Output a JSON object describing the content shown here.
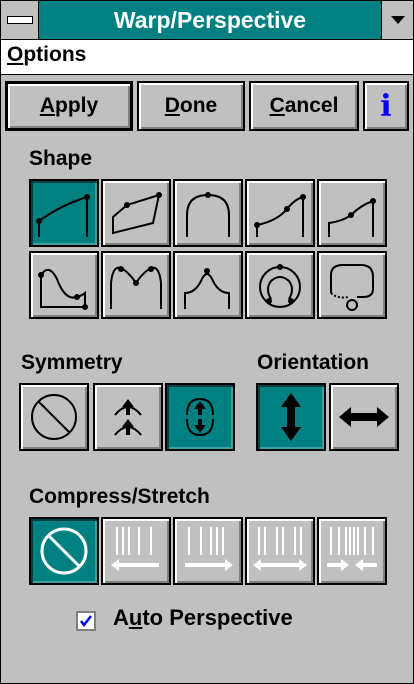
{
  "window": {
    "title": "Warp/Perspective"
  },
  "menu": {
    "options_label": "Options",
    "options_mnemonic": "O",
    "options_rest": "ptions"
  },
  "buttons": {
    "apply": {
      "mn": "A",
      "rest": "pply"
    },
    "done": {
      "mn": "D",
      "rest": "one"
    },
    "cancel": {
      "mn": "C",
      "rest": "ancel"
    },
    "info_glyph": "i"
  },
  "sections": {
    "shape": "Shape",
    "symmetry": "Symmetry",
    "orientation": "Orientation",
    "compress": "Compress/Stretch"
  },
  "shape_tiles": [
    {
      "icon": "shape-slant-curve-icon",
      "selected": true
    },
    {
      "icon": "shape-perspective-box-icon",
      "selected": false
    },
    {
      "icon": "shape-arch-icon",
      "selected": false
    },
    {
      "icon": "shape-rising-curve-icon",
      "selected": false
    },
    {
      "icon": "shape-step-curve-icon",
      "selected": false
    },
    {
      "icon": "shape-wave-icon",
      "selected": false
    },
    {
      "icon": "shape-double-hump-icon",
      "selected": false
    },
    {
      "icon": "shape-bell-icon",
      "selected": false
    },
    {
      "icon": "shape-circle-icon",
      "selected": false
    },
    {
      "icon": "shape-bubble-icon",
      "selected": false
    }
  ],
  "symmetry_tiles": [
    {
      "icon": "no-symmetry-icon",
      "selected": false
    },
    {
      "icon": "mirror-symmetry-icon",
      "selected": false
    },
    {
      "icon": "point-symmetry-icon",
      "selected": true
    }
  ],
  "orientation_tiles": [
    {
      "icon": "vertical-arrows-icon",
      "selected": true
    },
    {
      "icon": "horizontal-arrows-icon",
      "selected": false
    }
  ],
  "compress_tiles": [
    {
      "icon": "no-compress-icon",
      "selected": true,
      "enabled": true
    },
    {
      "icon": "stretch-left-icon",
      "selected": false,
      "enabled": false
    },
    {
      "icon": "stretch-right-icon",
      "selected": false,
      "enabled": false
    },
    {
      "icon": "stretch-both-icon",
      "selected": false,
      "enabled": false
    },
    {
      "icon": "compress-center-icon",
      "selected": false,
      "enabled": false
    }
  ],
  "auto_perspective": {
    "checked": true,
    "pre": "A",
    "mn": "u",
    "post": "to Perspective"
  },
  "colors": {
    "accent": "#008080",
    "face": "#c0c0c0",
    "info": "#0000ff"
  }
}
